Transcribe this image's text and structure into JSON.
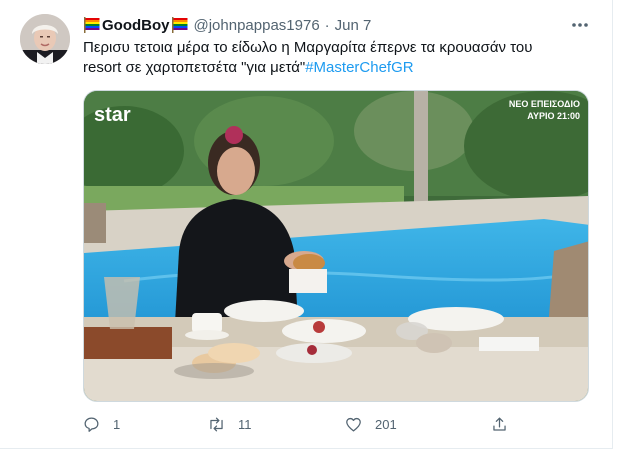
{
  "tweet": {
    "display_name": "GoodBoy",
    "handle": "@johnpappas1976",
    "separator": "·",
    "date": "Jun 7",
    "text": "Περισυ τετοια μέρα το είδωλο η Μαργαρίτα έπερνε τα κρουασάν του resort σε χαρτοπετσέτα \"για μετά\"",
    "hashtag": "#MasterChefGR"
  },
  "media": {
    "channel_logo": "star",
    "overlay_line1": "ΝΕΟ ΕΠΕΙΣΟΔΙΟ",
    "overlay_line2": "ΑΥΡΙΟ 21:00"
  },
  "actions": {
    "reply_count": "1",
    "retweet_count": "11",
    "like_count": "201"
  },
  "icons": {
    "name_prefix": "rainbow-flag-icon",
    "name_suffix": "rainbow-flag-icon",
    "more": "more-horizontal-icon",
    "reply": "reply-icon",
    "retweet": "retweet-icon",
    "like": "heart-icon",
    "share": "share-icon"
  },
  "colors": {
    "link": "#1d9bf0",
    "secondary_text": "#536471"
  }
}
